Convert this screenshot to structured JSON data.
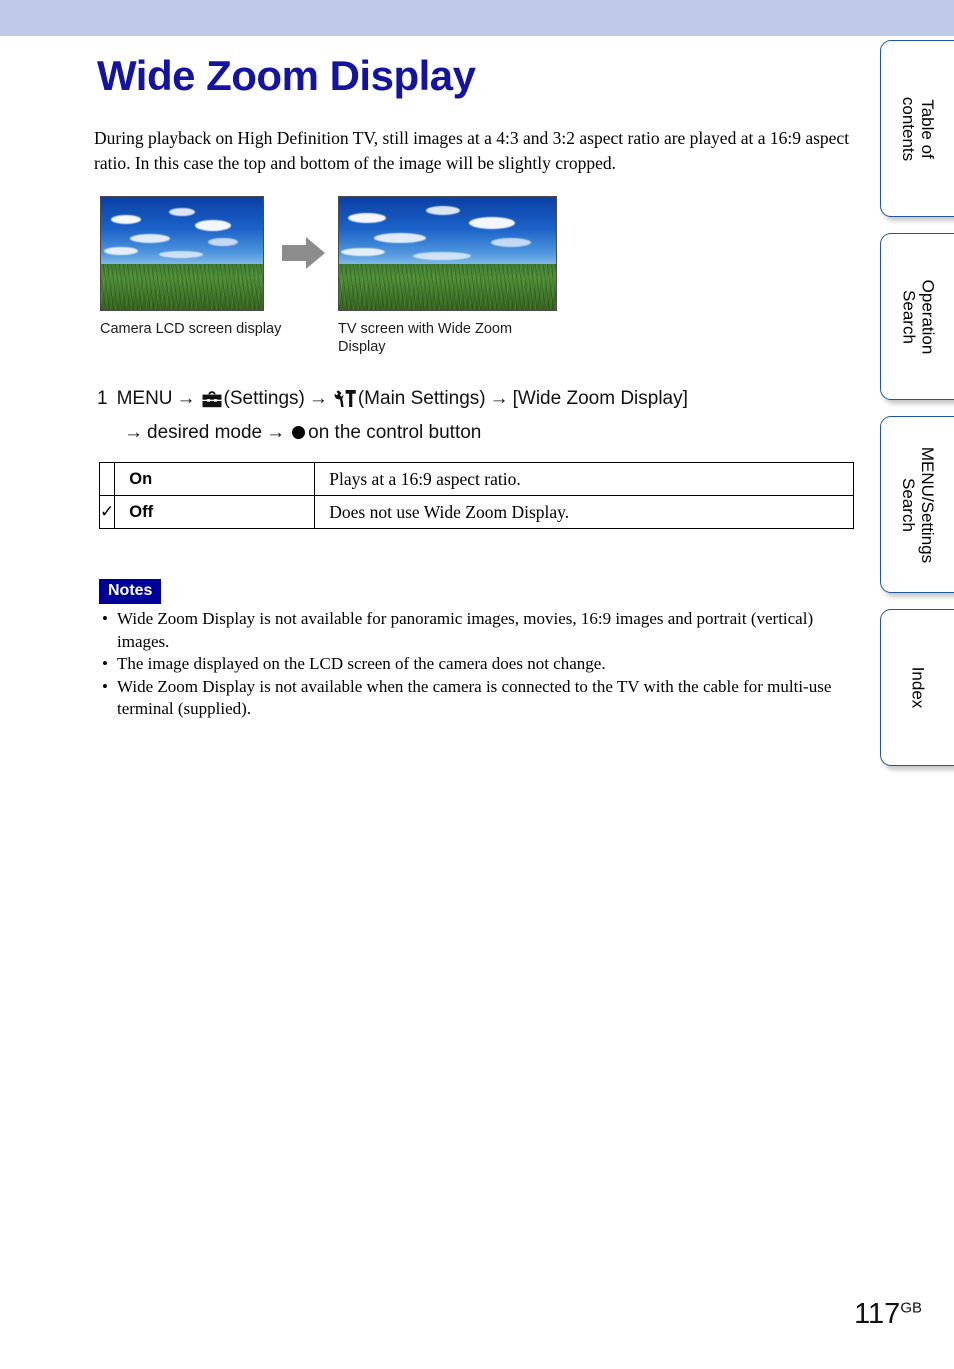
{
  "page": {
    "title": "Wide Zoom Display",
    "intro": "During playback on High Definition TV, still images at a 4:3 and 3:2 aspect ratio are played at a 16:9 aspect ratio. In this case the top and bottom of the image will be slightly cropped.",
    "page_number": "117",
    "page_number_suffix": "GB",
    "title_color": "#1414a0",
    "header_band_color": "#bfc9e8"
  },
  "figures": [
    {
      "caption": "Camera LCD screen display",
      "aspect": "4:3",
      "icon": "photo-cornfield-4x3"
    },
    {
      "caption": "TV screen with Wide Zoom Display",
      "aspect": "16:9",
      "icon": "photo-cornfield-16x9"
    }
  ],
  "arrow_icon": "right-arrow-icon",
  "step": {
    "number": "1",
    "menu_label": "MENU",
    "arrow": "→",
    "settings_icon": "toolbox-icon",
    "settings_label": "(Settings)",
    "main_settings_icon": "wrench-hammer-icon",
    "main_settings_label": "(Main Settings)",
    "item_label": "[Wide Zoom Display]",
    "line2_prefix": "desired mode",
    "center_button_icon": "center-dot-icon",
    "line2_suffix": "on the control button"
  },
  "settings_table": {
    "rows": [
      {
        "default_mark": "",
        "option": "On",
        "description": "Plays at a 16:9 aspect ratio."
      },
      {
        "default_mark": "✓",
        "option": "Off",
        "description": "Does not use Wide Zoom Display."
      }
    ]
  },
  "notes": {
    "heading": "Notes",
    "bullet": "•",
    "items": [
      "Wide Zoom Display is not available for panoramic images, movies, 16:9 images and portrait (vertical) images.",
      "The image displayed on the LCD screen of the camera does not change.",
      "Wide Zoom Display is not available when the camera is connected to the TV with the cable for multi-use terminal (supplied)."
    ]
  },
  "sidebar": {
    "tabs": [
      {
        "label": "Table of contents"
      },
      {
        "label": "Operation Search"
      },
      {
        "label": "MENU/Settings Search"
      },
      {
        "label": "Index"
      }
    ],
    "border_color": "#20569e"
  }
}
